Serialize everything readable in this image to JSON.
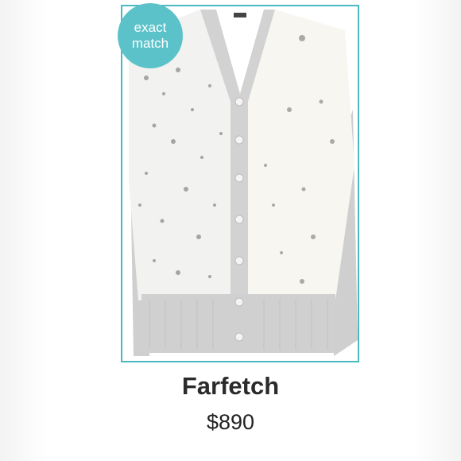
{
  "badge": {
    "line1": "exact",
    "line2": "match",
    "color": "#5bc2c9"
  },
  "product": {
    "brand": "Farfetch",
    "price": "$890",
    "frame_color": "#4cb8c0",
    "image_alt": "Grey and white floral print cardigan"
  }
}
